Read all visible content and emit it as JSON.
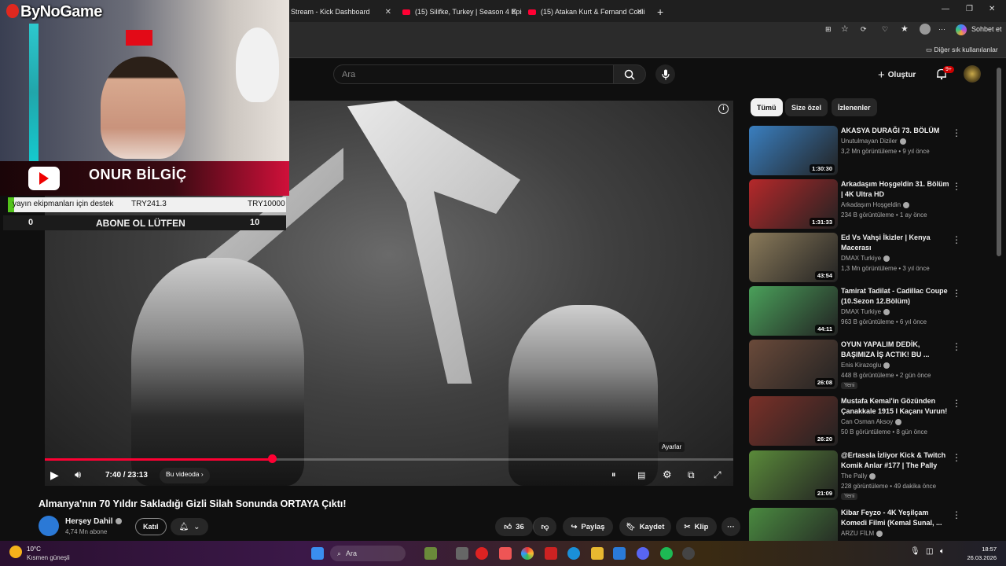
{
  "browser": {
    "tabs": [
      {
        "label": "Stream - Kick Dashboard"
      },
      {
        "label": "(15) Silifke, Turkey | Season 4 Episo"
      },
      {
        "label": "(15) Atakan Kurt & Fernand Couli"
      }
    ],
    "new_tab": "+",
    "sidebar_chat_button": "Sohbet et",
    "bookmarks_other": "Diğer sık kullanılanlar"
  },
  "header": {
    "search_placeholder": "Ara",
    "create_label": "Oluştur",
    "notification_badge": "9+"
  },
  "video": {
    "time": "7:40 / 23:13",
    "chapter": "Bu videoda",
    "progress": 0.33,
    "tooltip": "Ayarlar",
    "info": "i"
  },
  "meta": {
    "title": "Almanya'nın 70 Yıldır Sakladığı Gizli Silah Sonunda ORTAYA Çıktı!",
    "channel": "Herşey Dahil",
    "subscribers": "4,74 Mn abone",
    "join": "Katıl",
    "likes": "36",
    "share": "Paylaş",
    "save": "Kaydet",
    "clip": "Klip"
  },
  "filters": [
    "Tümü",
    "Size özel",
    "İzlenenler"
  ],
  "recommendations": [
    {
      "title": "AKASYA DURAĞI 73. BÖLÜM",
      "channel": "Unutulmayan Diziler",
      "meta": "3,2 Mn görüntüleme • 9 yıl önce",
      "duration": "1:30:30",
      "new": "",
      "color": "#3a7fc0"
    },
    {
      "title": "Arkadaşım Hoşgeldin 31. Bölüm | 4K Ultra HD",
      "channel": "Arkadaşım Hoşgeldin",
      "meta": "234 B görüntüleme • 1 ay önce",
      "duration": "1:31:33",
      "new": "",
      "color": "#b5282a"
    },
    {
      "title": "Ed Vs Vahşi İkizler | Kenya Macerası",
      "channel": "DMAX Turkiye",
      "meta": "1,3 Mn görüntüleme • 3 yıl önce",
      "duration": "43:54",
      "new": "",
      "color": "#8a7a5a"
    },
    {
      "title": "Tamirat Tadilat - Cadillac Coupe (10.Sezon 12.Bölüm)",
      "channel": "DMAX Turkiye",
      "meta": "963 B görüntüleme • 6 yıl önce",
      "duration": "44:11",
      "new": "",
      "color": "#4aa05a"
    },
    {
      "title": "OYUN YAPALIM DEDİK, BAŞIMIZA İŞ ACTIK! BU ...",
      "channel": "Enis Kirazoglu",
      "meta": "448 B görüntüleme • 2 gün önce",
      "duration": "26:08",
      "new": "Yeni",
      "color": "#6a4a3a"
    },
    {
      "title": "Mustafa Kemal'in Gözünden Çanakkale 1915 I Kaçanı Vurun!",
      "channel": "Can Osman Aksoy",
      "meta": "50 B görüntüleme • 8 gün önce",
      "duration": "26:20",
      "new": "",
      "color": "#7a3028"
    },
    {
      "title": "@Ertassla İzliyor Kick & Twitch Komik Anlar #177 | The Pally",
      "channel": "The Pally",
      "meta": "228 görüntüleme • 49 dakika önce",
      "duration": "21:09",
      "new": "Yeni",
      "color": "#5a8a3a"
    },
    {
      "title": "Kibar Feyzo - 4K Yeşilçam Komedi Filmi (Kemal Sunal, ...",
      "channel": "ARZU FİLM",
      "meta": "",
      "duration": "",
      "new": "",
      "color": "#4a8a40"
    }
  ],
  "overlay": {
    "logo": "ByNoGame",
    "streamer": "ONUR BİLGİÇ",
    "goal_label": "yayın ekipmanları için destek",
    "goal_current": "TRY241.3",
    "goal_target": "TRY10000",
    "goal_fraction": 0.024,
    "subs_left": "0",
    "subs_text": "ABONE OL LÜTFEN",
    "subs_right": "10"
  },
  "taskbar": {
    "temperature": "10°C",
    "weather": "Kısmen güneşli",
    "search": "Ara",
    "time": "18:57",
    "date": "26.03.2026"
  }
}
